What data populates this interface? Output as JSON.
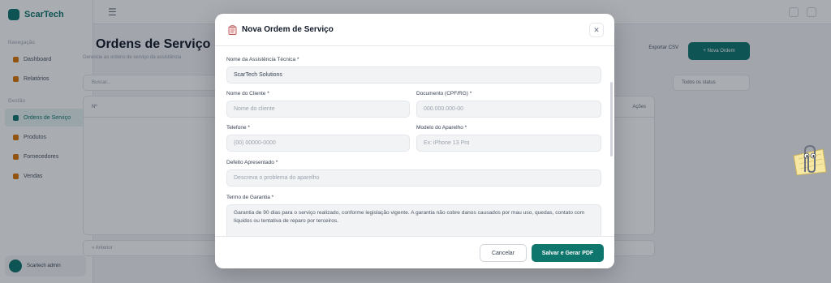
{
  "background": {
    "brand": "ScarTech",
    "nav_section_1": "Navegação",
    "nav_section_2": "Gestão",
    "nav_items": [
      "Dashboard",
      "Relatórios",
      "Ordens de Serviço",
      "Produtos",
      "Fornecedores",
      "Vendas"
    ],
    "user_name": "Scartech admin",
    "page_title": "Ordens de Serviço",
    "page_subtitle": "Gerencie as ordens de serviço da assistência",
    "export_label": "Exportar CSV",
    "new_order_label": "+ Nova Ordem",
    "search_placeholder": "Buscar...",
    "status_filter": "Todos os status",
    "table_col_first": "Nº",
    "table_col_last": "Ações",
    "pager_text": "« Anterior"
  },
  "modal": {
    "title": "Nova Ordem de Serviço",
    "title_icon": "clipboard-icon",
    "close_icon": "close-icon",
    "fields": {
      "assistencia_label": "Nome da Assistência Técnica *",
      "assistencia_value": "ScarTech Solutions",
      "cliente_label": "Nome do Cliente *",
      "cliente_placeholder": "Nome do cliente",
      "documento_label": "Documento (CPF/RG) *",
      "documento_placeholder": "000.000.000-00",
      "telefone_label": "Telefone *",
      "telefone_placeholder": "(00) 00000-0000",
      "modelo_label": "Modelo do Aparelho *",
      "modelo_placeholder": "Ex: iPhone 13 Pro",
      "defeito_label": "Defeito Apresentado *",
      "defeito_placeholder": "Descreva o problema do aparelho",
      "garantia_label": "Termo de Garantia *",
      "garantia_value": "Garantia de 90 dias para o serviço realizado, conforme legislação vigente. A garantia não cobre danos causados por mau uso, quedas, contato com líquidos ou tentativa de reparo por terceiros."
    },
    "cancel_label": "Cancelar",
    "save_label": "Salvar e Gerar PDF"
  },
  "colors": {
    "accent": "#0f766e",
    "overlay": "rgba(17,24,39,0.36)"
  }
}
